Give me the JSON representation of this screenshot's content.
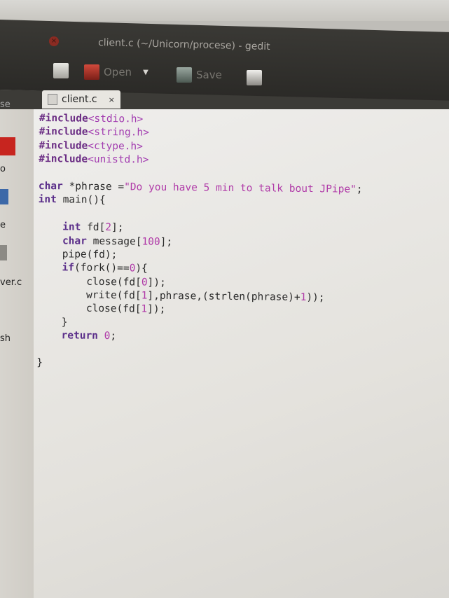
{
  "window": {
    "title": "client.c (~/Unicorn/procese) - gedit",
    "close_glyph": "×"
  },
  "toolbar": {
    "open_label": "Open",
    "save_label": "Save"
  },
  "tab": {
    "label": "client.c",
    "close_glyph": "×"
  },
  "side_panel": {
    "items": [
      "se",
      "o",
      "e",
      "ver.c",
      "sh"
    ]
  },
  "code": {
    "lines": [
      [
        {
          "t": "#include",
          "c": "pp"
        },
        {
          "t": "<stdio.h>",
          "c": "inc"
        }
      ],
      [
        {
          "t": "#include",
          "c": "pp"
        },
        {
          "t": "<string.h>",
          "c": "inc"
        }
      ],
      [
        {
          "t": "#include",
          "c": "pp"
        },
        {
          "t": "<ctype.h>",
          "c": "inc"
        }
      ],
      [
        {
          "t": "#include",
          "c": "pp"
        },
        {
          "t": "<unistd.h>",
          "c": "inc"
        }
      ],
      [],
      [
        {
          "t": "char",
          "c": "kw"
        },
        {
          "t": " *phrase =",
          "c": ""
        },
        {
          "t": "\"Do you have 5 min to talk bout JPipe\"",
          "c": "str"
        },
        {
          "t": ";",
          "c": ""
        }
      ],
      [
        {
          "t": "int",
          "c": "kw"
        },
        {
          "t": " main(){",
          "c": ""
        }
      ],
      [],
      [
        {
          "t": "    int",
          "c": "kw"
        },
        {
          "t": " fd[",
          "c": ""
        },
        {
          "t": "2",
          "c": "num"
        },
        {
          "t": "];",
          "c": ""
        }
      ],
      [
        {
          "t": "    char",
          "c": "kw"
        },
        {
          "t": " message[",
          "c": ""
        },
        {
          "t": "100",
          "c": "num"
        },
        {
          "t": "];",
          "c": ""
        }
      ],
      [
        {
          "t": "    pipe(fd);",
          "c": ""
        }
      ],
      [
        {
          "t": "    if",
          "c": "kw"
        },
        {
          "t": "(fork()==",
          "c": ""
        },
        {
          "t": "0",
          "c": "num"
        },
        {
          "t": "){",
          "c": ""
        }
      ],
      [
        {
          "t": "        close(fd[",
          "c": ""
        },
        {
          "t": "0",
          "c": "num"
        },
        {
          "t": "]);",
          "c": ""
        }
      ],
      [
        {
          "t": "        write(fd[",
          "c": ""
        },
        {
          "t": "1",
          "c": "num"
        },
        {
          "t": "],phrase,(strlen(phrase)+",
          "c": ""
        },
        {
          "t": "1",
          "c": "num"
        },
        {
          "t": "));",
          "c": ""
        }
      ],
      [
        {
          "t": "        close(fd[",
          "c": ""
        },
        {
          "t": "1",
          "c": "num"
        },
        {
          "t": "]);",
          "c": ""
        }
      ],
      [
        {
          "t": "    }",
          "c": ""
        }
      ],
      [
        {
          "t": "    return",
          "c": "kw"
        },
        {
          "t": " ",
          "c": ""
        },
        {
          "t": "0",
          "c": "num"
        },
        {
          "t": ";",
          "c": ""
        }
      ],
      [],
      [
        {
          "t": "}",
          "c": ""
        }
      ]
    ]
  },
  "colors": {
    "keyword": "#5b2f8a",
    "string": "#b03aa8",
    "preprocessor": "#6b2d84"
  }
}
